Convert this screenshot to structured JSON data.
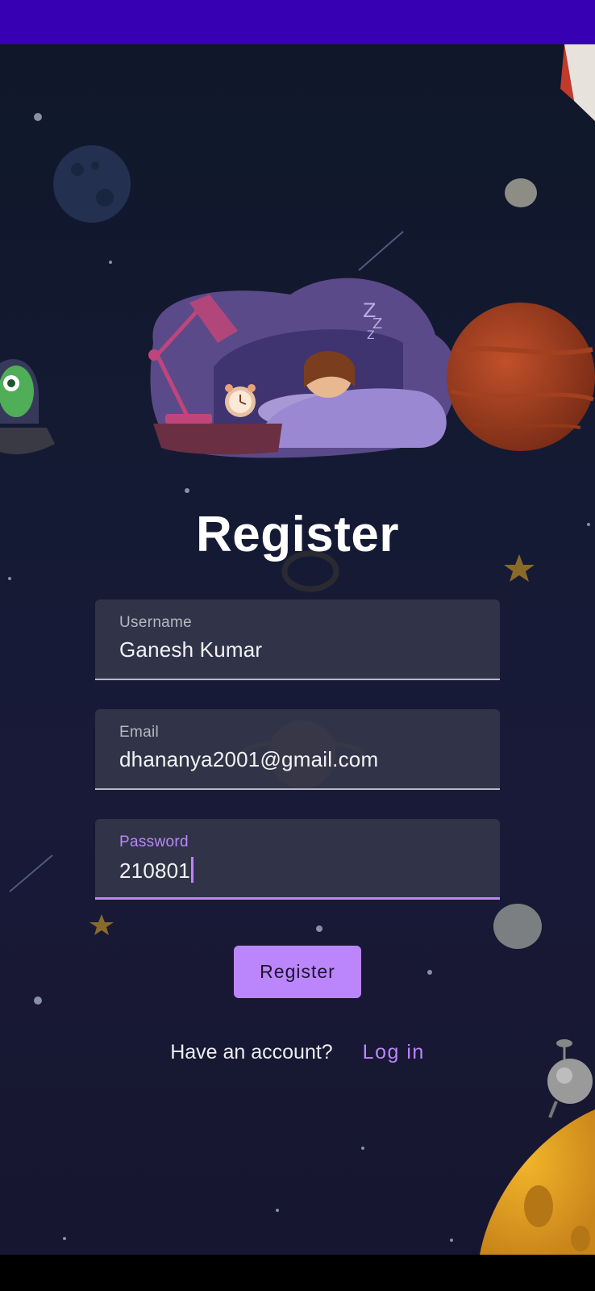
{
  "colors": {
    "status_bar": "#3700B3",
    "accent": "#bb86fc",
    "background": "#141a33"
  },
  "page": {
    "title": "Register"
  },
  "form": {
    "username": {
      "label": "Username",
      "value": "Ganesh Kumar"
    },
    "email": {
      "label": "Email",
      "value": "dhananya2001@gmail.com"
    },
    "password": {
      "label": "Password",
      "value": "210801",
      "focused": true
    }
  },
  "register_button": {
    "label": "Register"
  },
  "footer": {
    "question": "Have an account?",
    "login_link": "Log in"
  },
  "icons": [
    "sleeping-person-illustration",
    "lamp-icon",
    "alarm-clock-icon",
    "planet-icon",
    "alien-ufo-icon",
    "rocket-icon",
    "moon-icon",
    "star-icon",
    "asteroid-icon"
  ]
}
